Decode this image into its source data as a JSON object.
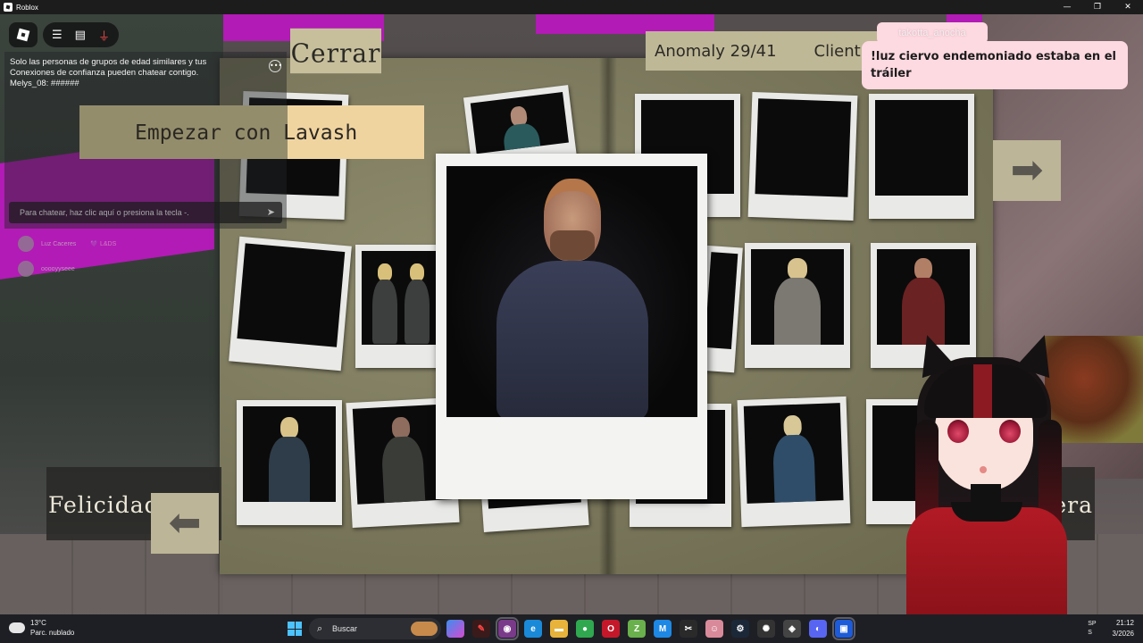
{
  "window": {
    "title": "Roblox",
    "controls": [
      "—",
      "❐",
      "✕"
    ]
  },
  "book": {
    "close_label": "Cerrar",
    "anomaly_label": "Anomaly 29/41",
    "client_label": "Client",
    "start_with_prefix": "Empezar con ",
    "start_with_name": "Lavash",
    "bottom_left_label": "Felicidades.",
    "bottom_right_label": "etera",
    "next_arrow": "➡",
    "prev_arrow": "⬅"
  },
  "chat": {
    "system_message": "Solo las personas de grupos de edad similares y tus Conexiones de confianza pueden chatear contigo.",
    "user_line": "Melys_08: ######",
    "input_placeholder": "Para chatear, haz clic aquí o presiona la tecla -.",
    "players": [
      {
        "name": "Luz Caceres",
        "tag": "💜 L&DS"
      },
      {
        "name": "ooooyyseee",
        "tag": ""
      }
    ]
  },
  "bubble": {
    "speaker": "takotta_anocha",
    "text": "!luz ciervo endemoniado estaba en el tráiler"
  },
  "taskbar": {
    "weather_temp": "13°C",
    "weather_desc": "Parc. nublado",
    "search_label": "Buscar",
    "lang": "SP",
    "lang2": "S",
    "time": "21:12",
    "date": "3/2026"
  },
  "colors": {
    "book": "#7d7a5c",
    "button": "#c7bf9c",
    "highlight": "#f0d4a0",
    "bubble": "#fdd9e1",
    "accent_magenta": "#b21bb5"
  }
}
